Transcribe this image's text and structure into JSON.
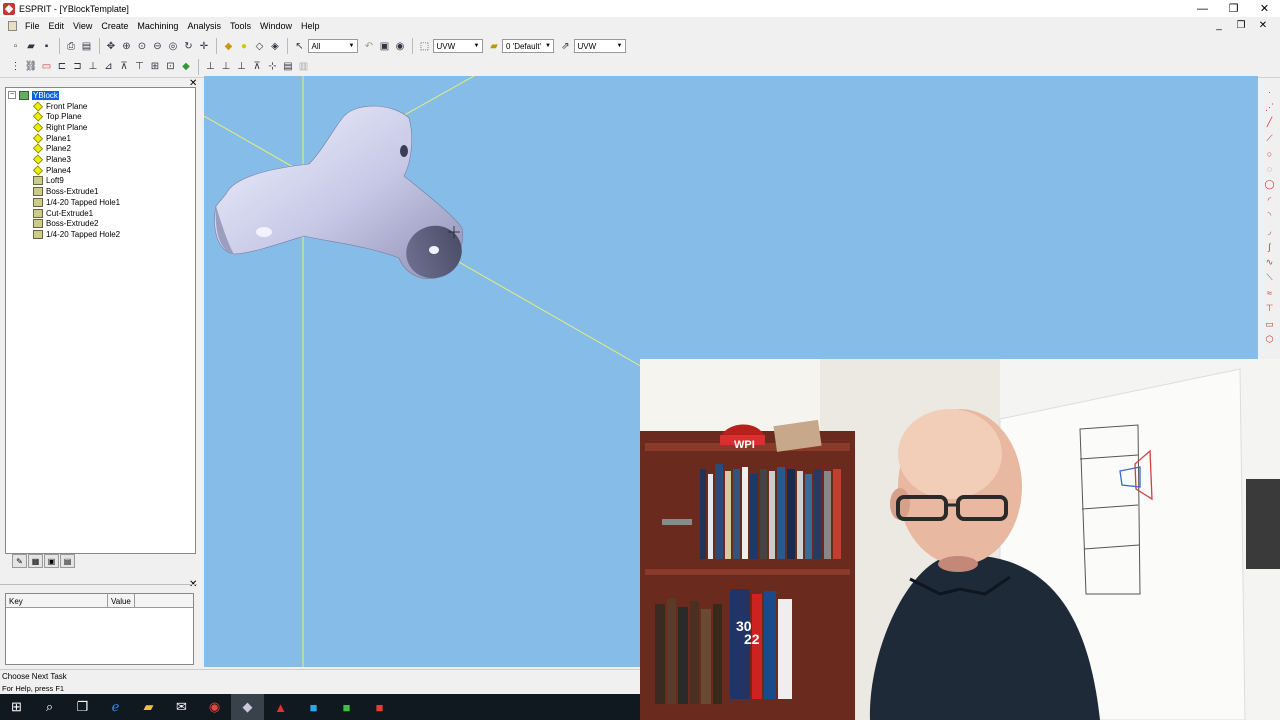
{
  "window": {
    "title": "ESPRIT - [YBlockTemplate]"
  },
  "menu": [
    "File",
    "Edit",
    "View",
    "Create",
    "Machining",
    "Analysis",
    "Tools",
    "Window",
    "Help"
  ],
  "toolbar": {
    "filter_combo": "All",
    "workplane_combo": "UVW",
    "layer_combo": "0 'Default'",
    "view_combo": "UVW"
  },
  "tree": {
    "root": "YBlock",
    "items": [
      {
        "label": "Front Plane",
        "icon": "plane-icon"
      },
      {
        "label": "Top Plane",
        "icon": "plane-icon"
      },
      {
        "label": "Right Plane",
        "icon": "plane-icon"
      },
      {
        "label": "Plane1",
        "icon": "plane-icon"
      },
      {
        "label": "Plane2",
        "icon": "plane-icon"
      },
      {
        "label": "Plane3",
        "icon": "plane-icon"
      },
      {
        "label": "Plane4",
        "icon": "plane-icon"
      },
      {
        "label": "Loft9",
        "icon": "loft-icon"
      },
      {
        "label": "Boss-Extrude1",
        "icon": "feature-icon"
      },
      {
        "label": "1/4-20 Tapped Hole1",
        "icon": "feature-icon"
      },
      {
        "label": "Cut-Extrude1",
        "icon": "feature-icon"
      },
      {
        "label": "Boss-Extrude2",
        "icon": "feature-icon"
      },
      {
        "label": "1/4-20 Tapped Hole2",
        "icon": "feature-icon"
      }
    ]
  },
  "properties": {
    "key_header": "Key",
    "value_header": "Value"
  },
  "status": {
    "line1": "Choose Next Task",
    "line2": "For Help, press F1"
  },
  "webcam": {
    "cap_text": "WPI",
    "book_text_1": "22",
    "book_text_2": "30"
  },
  "colors": {
    "viewport": "#85bde8",
    "selection": "#0a64d8",
    "axis": "#e6ee7a"
  }
}
